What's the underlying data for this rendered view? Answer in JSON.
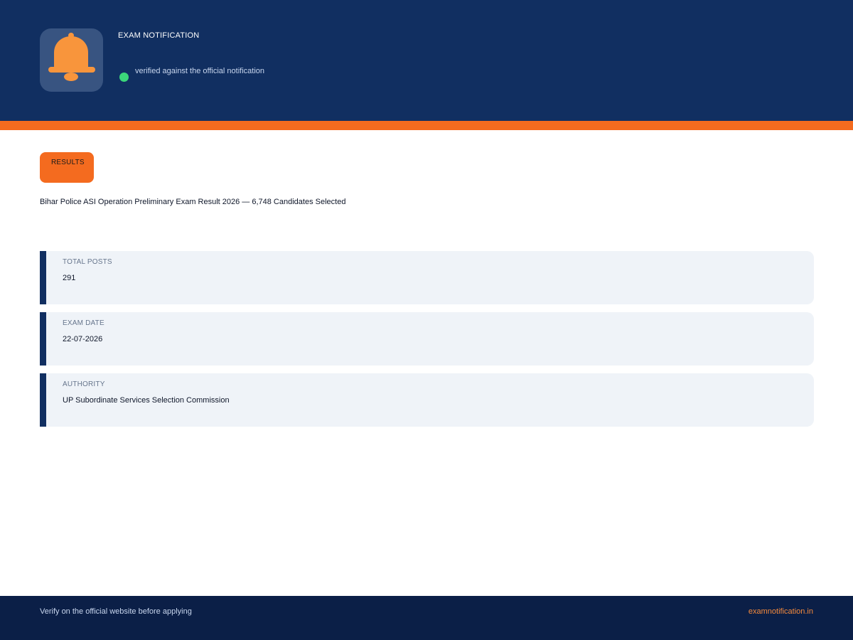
{
  "header": {
    "app_icon": "bell-icon",
    "label": "EXAM NOTIFICATION",
    "status_text": "verified against the official notification"
  },
  "main": {
    "tag": "RESULTS",
    "headline": "Bihar Police ASI Operation Preliminary Exam Result 2026 — 6,748 Candidates Selected",
    "cards": [
      {
        "label": "TOTAL POSTS",
        "value": "291"
      },
      {
        "label": "EXAM DATE",
        "value": "22-07-2026"
      },
      {
        "label": "AUTHORITY",
        "value": "UP Subordinate Services Selection Commission"
      }
    ]
  },
  "footer": {
    "note": "Verify on the official website before applying",
    "site": "examnotification.in"
  },
  "colors": {
    "header_bg": "#112f61",
    "accent_orange": "#f46b1f",
    "status_green": "#3bd67a",
    "card_bg": "#eff3f8",
    "footer_bg": "#0b1f47"
  }
}
